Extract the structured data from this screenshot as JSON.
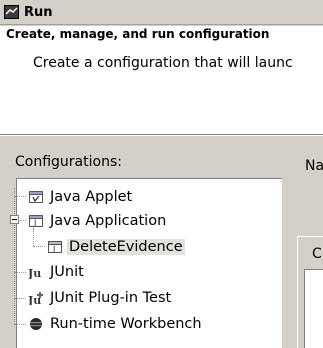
{
  "window": {
    "title": "Run",
    "icon": "run-app-icon"
  },
  "header": {
    "title": "Create, manage, and run configuration",
    "description": "Create a configuration that will launc"
  },
  "configurations": {
    "label": "Configurations:",
    "tree": [
      {
        "label": "Java Applet",
        "icon": "java-applet-icon",
        "level": 1
      },
      {
        "label": "Java Application",
        "icon": "java-application-icon",
        "level": 1,
        "expanded": true
      },
      {
        "label": "DeleteEvidence",
        "icon": "java-config-icon",
        "level": 2,
        "selected": true
      },
      {
        "label": "JUnit",
        "icon": "junit-icon",
        "level": 1
      },
      {
        "label": "JUnit Plug-in Test",
        "icon": "junit-plugin-icon",
        "level": 1
      },
      {
        "label": "Run-time Workbench",
        "icon": "workbench-icon",
        "level": 1
      }
    ]
  },
  "editor": {
    "name_label": "Na",
    "tab_label": "C"
  }
}
